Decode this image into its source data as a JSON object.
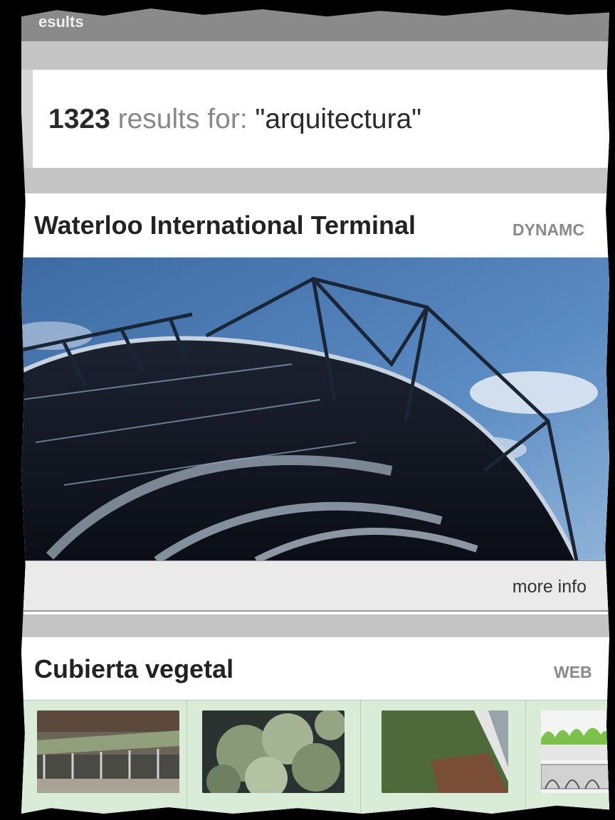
{
  "header": {
    "strip_label": "esults"
  },
  "results": {
    "count": "1323",
    "label": " results for: ",
    "query": "\"arquitectura\""
  },
  "cards": [
    {
      "title": "Waterloo International Terminal",
      "tag": "DYNAMC",
      "more_label": "more info"
    },
    {
      "title": "Cubierta vegetal",
      "tag": "WEB"
    }
  ],
  "colors": {
    "sky": "#4f7fb5",
    "thumb_row": "#d9ecd8",
    "bar": "#c4c4c4"
  }
}
